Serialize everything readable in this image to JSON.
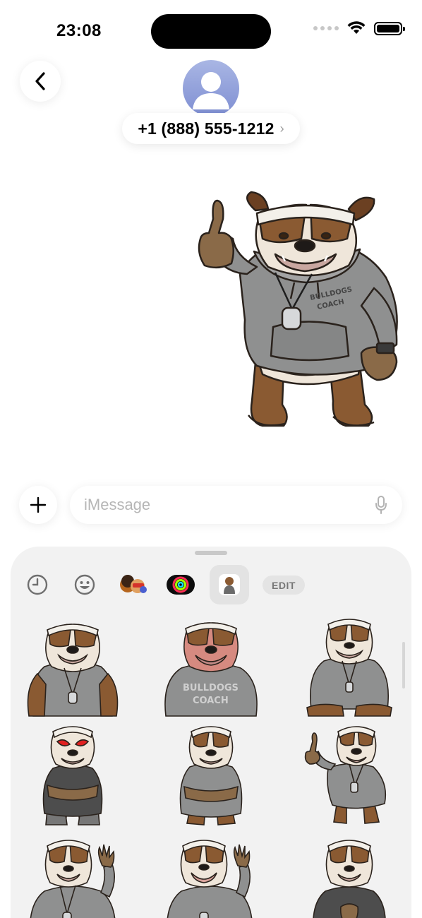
{
  "status_bar": {
    "time": "23:08"
  },
  "header": {
    "contact": "+1 (888) 555-1212",
    "chevron": "›"
  },
  "compose": {
    "placeholder": "iMessage"
  },
  "drawer": {
    "edit_label": "EDIT",
    "tabs": [
      {
        "icon": "recent-clock-icon",
        "active": false
      },
      {
        "icon": "emoji-icon",
        "active": false
      },
      {
        "icon": "memoji-icon",
        "active": false
      },
      {
        "icon": "activity-rings-icon",
        "active": false
      },
      {
        "icon": "bulldog-sticker-pack-icon",
        "active": true
      }
    ],
    "stickers": [
      {
        "pose": "tank-top muscle"
      },
      {
        "pose": "angry red face bulldogs coach"
      },
      {
        "pose": "sitting"
      },
      {
        "pose": "red eyes arms crossed"
      },
      {
        "pose": "arms crossed"
      },
      {
        "pose": "thumbs up coach"
      },
      {
        "pose": "waving"
      },
      {
        "pose": "waving smile"
      },
      {
        "pose": "hands clasped"
      }
    ]
  },
  "colors": {
    "hoodie": "#8f9090",
    "fur_brown": "#8a5a32",
    "fur_light": "#efe6da",
    "headband": "#f3f0ea",
    "avatar_gradient_top": "#a9b6e4",
    "avatar_gradient_bottom": "#7e8ed2"
  }
}
